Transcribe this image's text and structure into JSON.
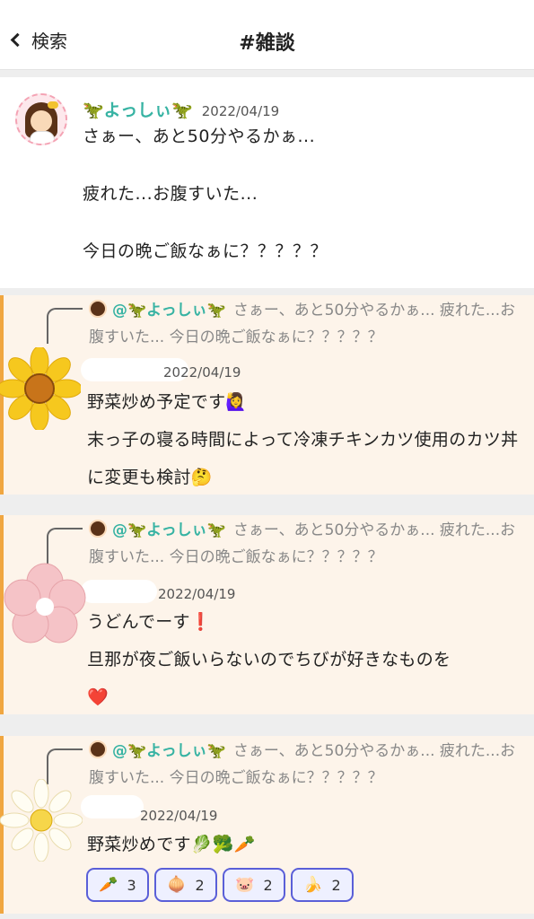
{
  "header": {
    "back_label": "検索",
    "title": "#雑談"
  },
  "post": {
    "username": "🦖よっしぃ🦖",
    "date": "2022/04/19",
    "text": "さぁー、あと50分やるかぁ...\n\n疲れた...お腹すいた...\n\n今日の晩ご飯なぁに？？？？？"
  },
  "quote": {
    "mention": "@🦖よっしぃ🦖",
    "excerpt": "さぁー、あと50分やるかぁ... 疲れた...お腹すいた... 今日の晩ご飯なぁに？？？？？"
  },
  "replies": [
    {
      "date": "2022/04/19",
      "text": "野菜炒め予定です🙋‍♀️\n末っ子の寝る時間によって冷凍チキンカツ使用のカツ丼に変更も検討🤔"
    },
    {
      "date": "2022/04/19",
      "text": "うどんでーす❗️\n旦那が夜ご飯いらないのでちびが好きなものを\n❤️"
    },
    {
      "date": "2022/04/19",
      "text": "野菜炒めです🥬🥦🥕"
    }
  ],
  "reactions": [
    {
      "icon": "carrot-icon",
      "emoji": "🥕",
      "count": "3"
    },
    {
      "icon": "onion-icon",
      "emoji": "🧅",
      "count": "2"
    },
    {
      "icon": "pig-icon",
      "emoji": "🐷",
      "count": "2"
    },
    {
      "icon": "banana-icon",
      "emoji": "🍌",
      "count": "2"
    }
  ],
  "colors": {
    "accent_teal": "#37b3a3",
    "card_bg": "#fdf4ea",
    "card_border": "#f0a640",
    "chip_border": "#5a5fd8"
  }
}
